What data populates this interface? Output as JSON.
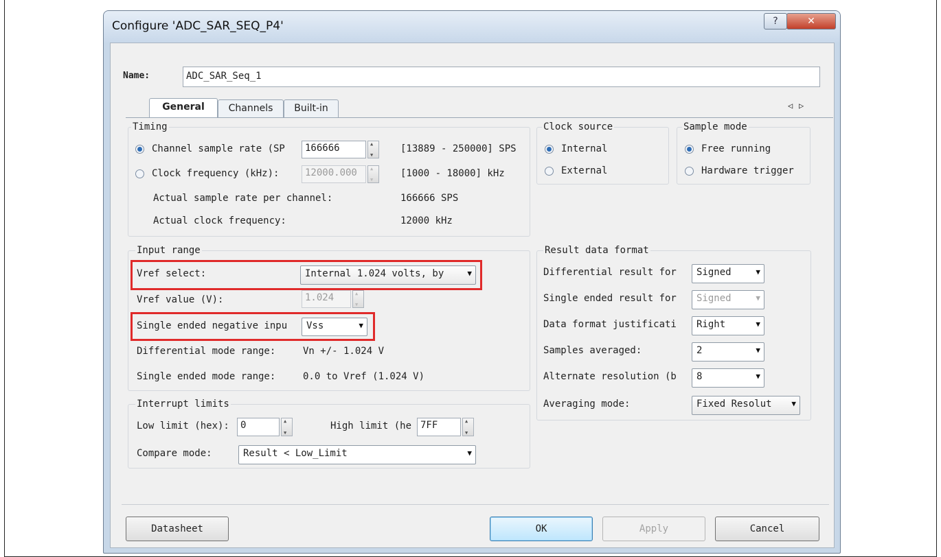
{
  "window": {
    "title": "Configure 'ADC_SAR_SEQ_P4'",
    "help_label": "?",
    "close_label": "✕"
  },
  "name_row": {
    "label": "Name:",
    "value": "ADC_SAR_Seq_1"
  },
  "tabs": [
    {
      "label": "General",
      "active": true
    },
    {
      "label": "Channels"
    },
    {
      "label": "Built-in"
    }
  ],
  "tab_scroll": {
    "left": "◁",
    "right": "▷"
  },
  "timing": {
    "title": "Timing",
    "channel_rate_label": "Channel sample rate (SP",
    "channel_rate_value": "166666",
    "channel_rate_range": "[13889 - 250000] SPS",
    "clock_freq_label": "Clock frequency (kHz):",
    "clock_freq_value": "12000.000",
    "clock_freq_range": "[1000 - 18000] kHz",
    "actual_rate_label": "Actual sample rate per channel:",
    "actual_rate_value": "166666 SPS",
    "actual_clock_label": "Actual clock frequency:",
    "actual_clock_value": "12000 kHz"
  },
  "clock_source": {
    "title": "Clock source",
    "internal": "Internal",
    "external": "External",
    "selected": "Internal"
  },
  "sample_mode": {
    "title": "Sample mode",
    "free_running": "Free running",
    "hardware_trigger": "Hardware trigger",
    "selected": "Free running"
  },
  "input_range": {
    "title": "Input range",
    "vref_select_label": "Vref select:",
    "vref_select_value": "Internal 1.024 volts, by",
    "vref_value_label": "Vref value (V):",
    "vref_value": "1.024",
    "single_neg_label": "Single ended negative inpu",
    "single_neg_value": "Vss",
    "diff_range_label": "Differential mode range:",
    "diff_range_value": "Vn +/- 1.024 V",
    "single_range_label": "Single ended mode range:",
    "single_range_value": "0.0 to Vref (1.024 V)"
  },
  "result_format": {
    "title": "Result data format",
    "diff_label": "Differential result for",
    "diff_value": "Signed",
    "single_label": "Single ended result for",
    "single_value": "Signed",
    "justify_label": "Data format justificati",
    "justify_value": "Right",
    "samples_label": "Samples averaged:",
    "samples_value": "2",
    "alt_res_label": "Alternate resolution (b",
    "alt_res_value": "8",
    "avg_mode_label": "Averaging mode:",
    "avg_mode_value": "Fixed Resolut"
  },
  "interrupt": {
    "title": "Interrupt limits",
    "low_label": "Low limit (hex):",
    "low_value": "0",
    "high_label": "High limit (he",
    "high_value": "7FF",
    "compare_label": "Compare mode:",
    "compare_value": "Result < Low_Limit"
  },
  "buttons": {
    "datasheet": "Datasheet",
    "ok": "OK",
    "apply": "Apply",
    "cancel": "Cancel"
  }
}
